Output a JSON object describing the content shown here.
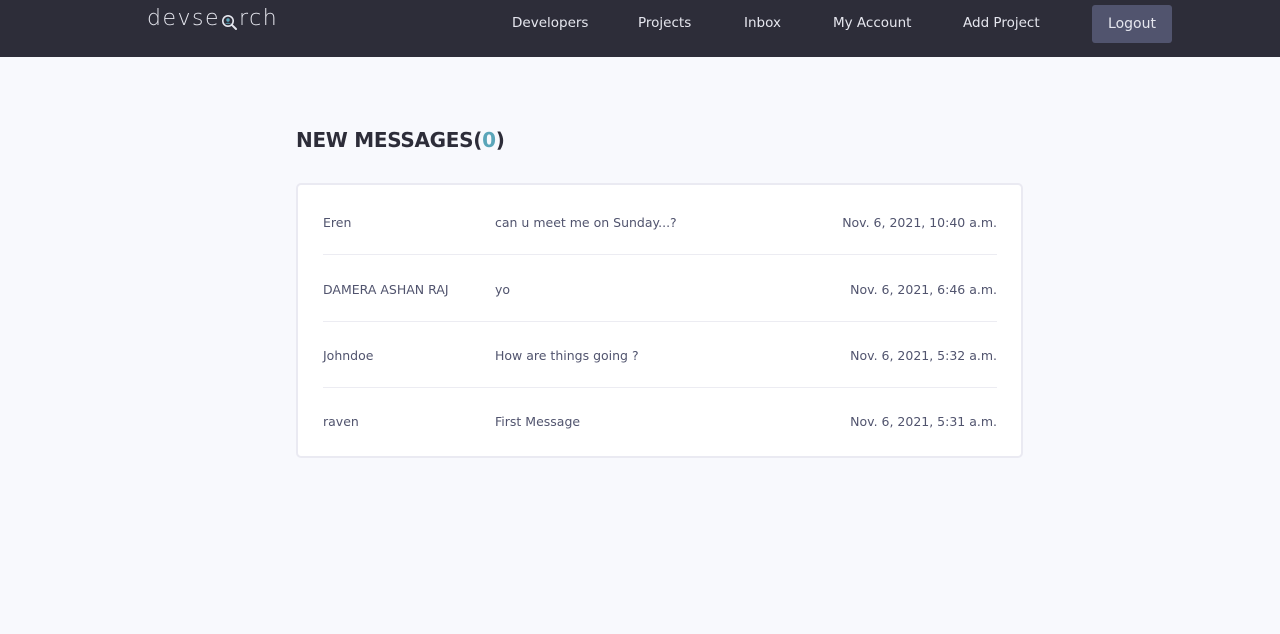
{
  "header": {
    "logo_prefix": "devse",
    "logo_suffix": "rch",
    "nav": [
      {
        "label": "Developers"
      },
      {
        "label": "Projects"
      },
      {
        "label": "Inbox"
      },
      {
        "label": "My Account"
      },
      {
        "label": "Add Project"
      }
    ],
    "logout_label": "Logout"
  },
  "colors": {
    "header_bg": "#2d2d39",
    "accent": "#5aa5b9",
    "logout_bg": "#51546e",
    "page_bg": "#f8f9fd"
  },
  "inbox": {
    "title": "NEW MESSAGES(",
    "count": "0",
    "title_close": ")",
    "messages": [
      {
        "sender": "Eren",
        "subject": "can u meet me on Sunday...?",
        "date": "Nov. 6, 2021, 10:40 a.m."
      },
      {
        "sender": "DAMERA ASHAN RAJ",
        "subject": "yo",
        "date": "Nov. 6, 2021, 6:46 a.m."
      },
      {
        "sender": "Johndoe",
        "subject": "How are things going ?",
        "date": "Nov. 6, 2021, 5:32 a.m."
      },
      {
        "sender": "raven",
        "subject": "First Message",
        "date": "Nov. 6, 2021, 5:31 a.m."
      }
    ]
  }
}
